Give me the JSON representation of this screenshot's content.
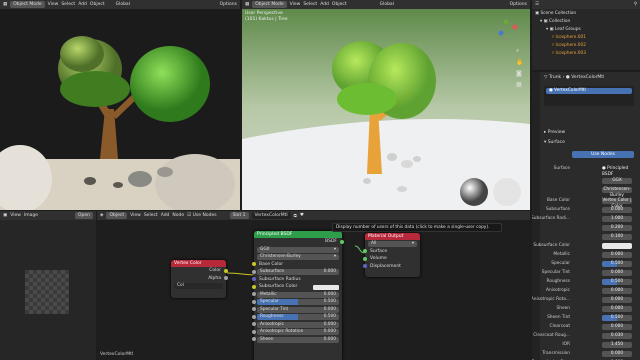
{
  "left_viewport": {
    "header": {
      "mode": "Object Mode",
      "menus": [
        "View",
        "Select",
        "Add",
        "Object"
      ],
      "orientation": "Global",
      "options": "Options"
    }
  },
  "right_viewport": {
    "header": {
      "mode": "Object Mode",
      "menus": [
        "View",
        "Select",
        "Add",
        "Object"
      ],
      "orientation": "Global",
      "options": "Options"
    },
    "overlay_title": "User Perspective",
    "overlay_subtitle": "(101) Kaktus | Tree"
  },
  "outliner": {
    "items": [
      {
        "label": "Scene Collection"
      },
      {
        "label": "Collection"
      },
      {
        "label": "Leaf Groups"
      },
      {
        "label": "Icosphere.001"
      },
      {
        "label": "Icosphere.002"
      },
      {
        "label": "Icosphere.003"
      }
    ]
  },
  "properties": {
    "breadcrumb_object": "Trunk",
    "breadcrumb_material": "VertexColorMtl",
    "material_name": "VertexColorMtl",
    "preview_label": "Preview",
    "surface_label": "Surface",
    "use_nodes_label": "Use Nodes",
    "surface_row": {
      "label": "Surface",
      "value": "Principled BSDF"
    },
    "distribution": "GGX",
    "subsurface_method": "Christensen-Burley",
    "rows": [
      {
        "label": "Base Color",
        "value": "Vertex Color | Color",
        "style": "plain"
      },
      {
        "label": "Subsurface",
        "value": "0.000",
        "style": "plain"
      },
      {
        "label": "Subsurface Radi...",
        "value": "1.000",
        "style": "plain"
      },
      {
        "label": "",
        "value": "0.200",
        "style": "plain"
      },
      {
        "label": "",
        "value": "0.100",
        "style": "plain"
      },
      {
        "label": "Subsurface Color",
        "value": "",
        "style": "white"
      },
      {
        "label": "Metallic",
        "value": "0.000",
        "style": "plain"
      },
      {
        "label": "Specular",
        "value": "0.500",
        "style": "blue"
      },
      {
        "label": "Specular Tint",
        "value": "0.000",
        "style": "plain"
      },
      {
        "label": "Roughness",
        "value": "0.500",
        "style": "blue"
      },
      {
        "label": "Anisotropic",
        "value": "0.000",
        "style": "plain"
      },
      {
        "label": "Anisotropic Rota...",
        "value": "0.000",
        "style": "plain"
      },
      {
        "label": "Sheen",
        "value": "0.000",
        "style": "plain"
      },
      {
        "label": "Sheen Tint",
        "value": "0.500",
        "style": "blue"
      },
      {
        "label": "Clearcoat",
        "value": "0.000",
        "style": "plain"
      },
      {
        "label": "Clearcoat Roug...",
        "value": "0.030",
        "style": "plain"
      },
      {
        "label": "IOR",
        "value": "1.450",
        "style": "plain"
      },
      {
        "label": "Transmission",
        "value": "0.000",
        "style": "plain"
      },
      {
        "label": "Transmission Ro...",
        "value": "0.000",
        "style": "plain"
      }
    ]
  },
  "image_editor": {
    "header": {
      "menus": [
        "View",
        "Image"
      ],
      "open_label": "Open"
    }
  },
  "node_editor": {
    "header": {
      "object_label": "Object",
      "menus": [
        "View",
        "Select",
        "Add",
        "Node"
      ],
      "use_nodes": "Use Nodes",
      "slot": "Slot 1",
      "material": "VertexColorMtl"
    },
    "tooltip": "Display number of users of this data (click to make a single-user copy).",
    "footer_label": "VertexColorMtl",
    "vertex_color_node": {
      "title": "Vertex Color",
      "outputs": [
        "Color",
        "Alpha"
      ],
      "field": "Col"
    },
    "bsdf_node": {
      "title": "Principled BSDF",
      "output": "BSDF",
      "distribution": "GGX",
      "method": "Christensen-Burley",
      "rows": [
        {
          "label": "Base Color",
          "value": "",
          "kind": "link"
        },
        {
          "label": "Subsurface",
          "value": "0.000",
          "kind": "field"
        },
        {
          "label": "Subsurface Radius",
          "value": "",
          "kind": "label"
        },
        {
          "label": "Subsurface Color",
          "value": "",
          "kind": "color"
        },
        {
          "label": "Metallic",
          "value": "0.000",
          "kind": "field"
        },
        {
          "label": "Specular",
          "value": "0.500",
          "kind": "blue"
        },
        {
          "label": "Specular Tint",
          "value": "0.000",
          "kind": "field"
        },
        {
          "label": "Roughness",
          "value": "0.500",
          "kind": "blue"
        },
        {
          "label": "Anisotropic",
          "value": "0.000",
          "kind": "field"
        },
        {
          "label": "Anisotropic Rotation",
          "value": "0.000",
          "kind": "field"
        },
        {
          "label": "Sheen",
          "value": "0.000",
          "kind": "field"
        }
      ]
    },
    "output_node": {
      "title": "Material Output",
      "target": "All",
      "inputs": [
        "Surface",
        "Volume",
        "Displacement"
      ]
    }
  },
  "colors": {
    "accent_blue": "#4772b3",
    "shader_green": "#2e9e4a",
    "input_red": "#b8283b",
    "socket_yellow": "#c7c729",
    "socket_green": "#63c763",
    "socket_grey": "#a1a1a1",
    "socket_purple": "#6363c7"
  }
}
